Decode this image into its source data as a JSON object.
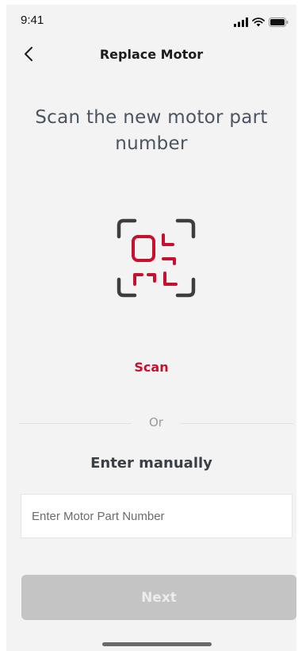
{
  "status_bar": {
    "time": "9:41",
    "icons": [
      "signal-icon",
      "wifi-icon",
      "battery-icon"
    ]
  },
  "nav": {
    "back_icon": "chevron-left-icon",
    "title": "Replace Motor"
  },
  "main": {
    "heading": "Scan the new motor part number",
    "scan_icon": "qr-scan-icon",
    "scan_label": "Scan",
    "divider_text": "Or",
    "manual_label": "Enter manually",
    "part_input": {
      "value": "",
      "placeholder": "Enter Motor Part Number"
    }
  },
  "footer": {
    "next_label": "Next"
  },
  "colors": {
    "accent": "#c8102e",
    "background": "#f3f3f3",
    "heading_text": "#4b5561",
    "disabled_button": "#c4c4c4"
  }
}
